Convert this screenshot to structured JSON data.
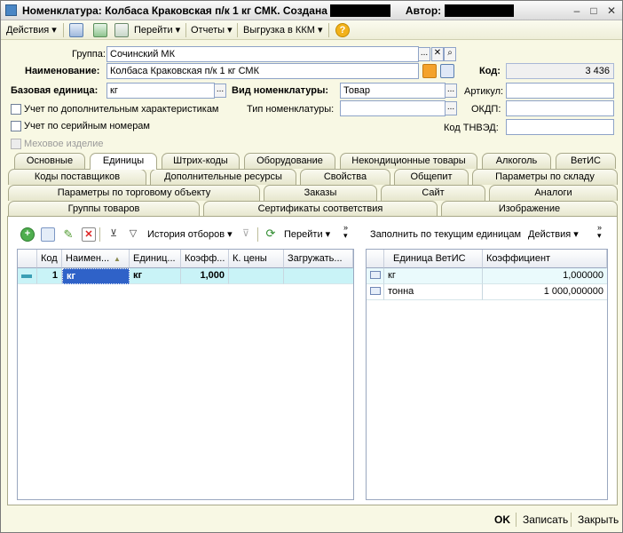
{
  "window": {
    "title": "Номенклатура: Колбаса Краковская п/к 1 кг СМК. Создана",
    "author_label": "Автор:"
  },
  "toolbar": {
    "actions": "Действия",
    "goto": "Перейти",
    "reports": "Отчеты",
    "export": "Выгрузка в ККМ"
  },
  "form": {
    "group_label": "Группа:",
    "group_value": "Сочинский МК",
    "name_label": "Наименование:",
    "name_value": "Колбаса Краковская п/к 1 кг СМК",
    "code_label": "Код:",
    "code_value": "3 436",
    "base_unit_label": "Базовая единица:",
    "base_unit_value": "кг",
    "kind_label": "Вид номенклатуры:",
    "kind_value": "Товар",
    "article_label": "Артикул:",
    "article_value": "",
    "extra_char_label": "Учет по дополнительным характеристикам",
    "type_label": "Тип номенклатуры:",
    "type_value": "",
    "okdp_label": "ОКДП:",
    "okdp_value": "",
    "serial_label": "Учет по серийным номерам",
    "tnved_label": "Код ТНВЭД:",
    "tnved_value": "",
    "fur_label": "Меховое изделие"
  },
  "tabs": {
    "row1": [
      "Основные",
      "Единицы",
      "Штрих-коды",
      "Оборудование",
      "Некондиционные товары",
      "Алкоголь",
      "ВетИС"
    ],
    "row2": [
      "Коды поставщиков",
      "Дополнительные ресурсы",
      "Свойства",
      "Общепит",
      "Параметры по складу"
    ],
    "row3": [
      "Параметры по торговому объекту",
      "Заказы",
      "Сайт",
      "Аналоги"
    ],
    "row4": [
      "Группы товаров",
      "Сертификаты соответствия",
      "Изображение"
    ]
  },
  "left_toolbar": {
    "history": "История отборов",
    "goto": "Перейти"
  },
  "left_grid": {
    "headers": [
      "Код",
      "Наимен...",
      "Единиц...",
      "Коэфф...",
      "К. цены",
      "Загружать..."
    ],
    "rows": [
      {
        "code": "1",
        "name": "кг",
        "unit": "кг",
        "coef": "1,000",
        "price_k": "",
        "load": ""
      }
    ]
  },
  "right_toolbar": {
    "fill": "Заполнить по текущим единицам",
    "actions": "Действия"
  },
  "right_grid": {
    "headers": [
      "Единица ВетИС",
      "Коэффициент"
    ],
    "rows": [
      {
        "unit": "кг",
        "coef": "1,000000"
      },
      {
        "unit": "тонна",
        "coef": "1 000,000000"
      }
    ]
  },
  "footer": {
    "ok": "OK",
    "save": "Записать",
    "close": "Закрыть"
  },
  "colors": {
    "selected_row": "#c9f3f7",
    "selected_cell": "#2f62c8",
    "form_bg": "#f8f8e4"
  }
}
